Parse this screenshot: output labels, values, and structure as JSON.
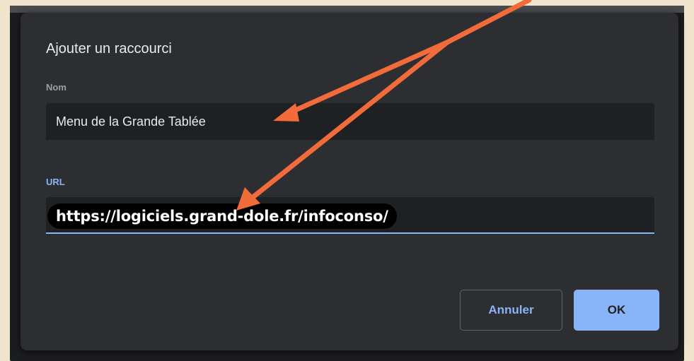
{
  "dialog": {
    "title": "Ajouter un raccourci",
    "name_field": {
      "label": "Nom",
      "value": "Menu de la Grande Tablée"
    },
    "url_field": {
      "label": "URL",
      "value": "https://logiciels.grand-dole.fr/infoconso/"
    },
    "buttons": {
      "cancel_label": "Annuler",
      "ok_label": "OK"
    }
  },
  "colors": {
    "page_background": "#f1e4cc",
    "dialog_background": "#2d2e31",
    "field_background": "#1f2023",
    "accent_blue": "#8ab4f8",
    "annotation_arrow": "#f26b3a"
  },
  "annotations": {
    "arrow_icon": "arrow-pointer-icon"
  }
}
